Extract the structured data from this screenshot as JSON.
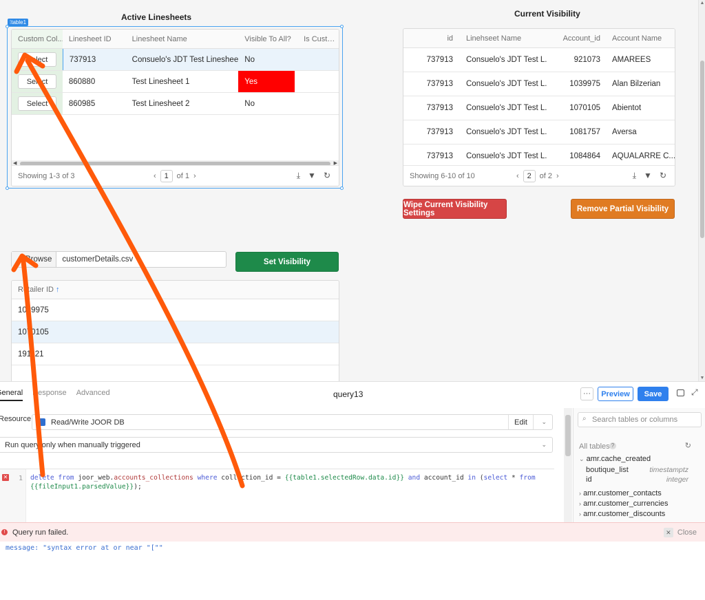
{
  "active_linesheets": {
    "title": "Active Linesheets",
    "badge": "table1",
    "columns": [
      "Custom Col...",
      "Linesheet ID",
      "Linesheet Name",
      "Visible To All?",
      "Is Custom?"
    ],
    "rows": [
      {
        "button": "Select",
        "id": "737913",
        "name": "Consuelo's JDT Test Linesheet",
        "visible": "No"
      },
      {
        "button": "Select",
        "id": "860880",
        "name": "Test Linesheet 1",
        "visible": "Yes"
      },
      {
        "button": "Select",
        "id": "860985",
        "name": "Test Linesheet 2",
        "visible": "No"
      }
    ],
    "footer": "Showing 1-3 of 3",
    "page": "1",
    "page_of": "of 1"
  },
  "current_visibility": {
    "title": "Current Visibility",
    "columns": [
      "id",
      "Linehseet Name",
      "Account_id",
      "Account Name"
    ],
    "rows": [
      {
        "id": "737913",
        "name": "Consuelo's JDT Test L...",
        "account_id": "921073",
        "account_name": "AMAREES"
      },
      {
        "id": "737913",
        "name": "Consuelo's JDT Test L...",
        "account_id": "1039975",
        "account_name": "Alan Bilzerian"
      },
      {
        "id": "737913",
        "name": "Consuelo's JDT Test L...",
        "account_id": "1070105",
        "account_name": "Abientot"
      },
      {
        "id": "737913",
        "name": "Consuelo's JDT Test L...",
        "account_id": "1081757",
        "account_name": "Aversa"
      },
      {
        "id": "737913",
        "name": "Consuelo's JDT Test L...",
        "account_id": "1084864",
        "account_name": "AQUALARRE C..."
      }
    ],
    "footer": "Showing 6-10 of 10",
    "page": "2",
    "page_of": "of 2"
  },
  "buttons": {
    "wipe": "Wipe Current Visibility Settings",
    "remove_partial": "Remove Partial Visibility",
    "set_visibility": "Set Visibility",
    "browse": "Browse"
  },
  "file_input": {
    "value": "customerDetails.csv"
  },
  "retailer_table": {
    "column": "Retailer ID",
    "rows": [
      "1039975",
      "1070105",
      "191121"
    ]
  },
  "query_panel": {
    "tabs": [
      "General",
      "Response",
      "Advanced"
    ],
    "query_name": "query13",
    "preview": "Preview",
    "save": "Save",
    "resource_label": "Resource",
    "resource_value": "Read/Write JOOR DB",
    "edit": "Edit",
    "run_mode": "Run query only when manually triggered",
    "line_number": "1",
    "error_title": "Query run failed.",
    "close": "Close",
    "error_message": "message: \"syntax error at or near \"[\"\""
  },
  "schema": {
    "search_placeholder": "Search tables or columns",
    "all_tables": "All tables",
    "tables": [
      "amr.cache_created",
      "amr.customer_contacts",
      "amr.customer_currencies",
      "amr.customer_discounts"
    ],
    "columns": [
      {
        "name": "boutique_list",
        "type": "timestamptz"
      },
      {
        "name": "id",
        "type": "integer"
      }
    ]
  },
  "colors": {
    "yes_cell": "#ff0000",
    "wipe": "#d64545",
    "remove": "#e07b22",
    "set": "#1e8a4a",
    "save": "#2f80ed",
    "annotation_arrow": "#ff5a0a"
  }
}
